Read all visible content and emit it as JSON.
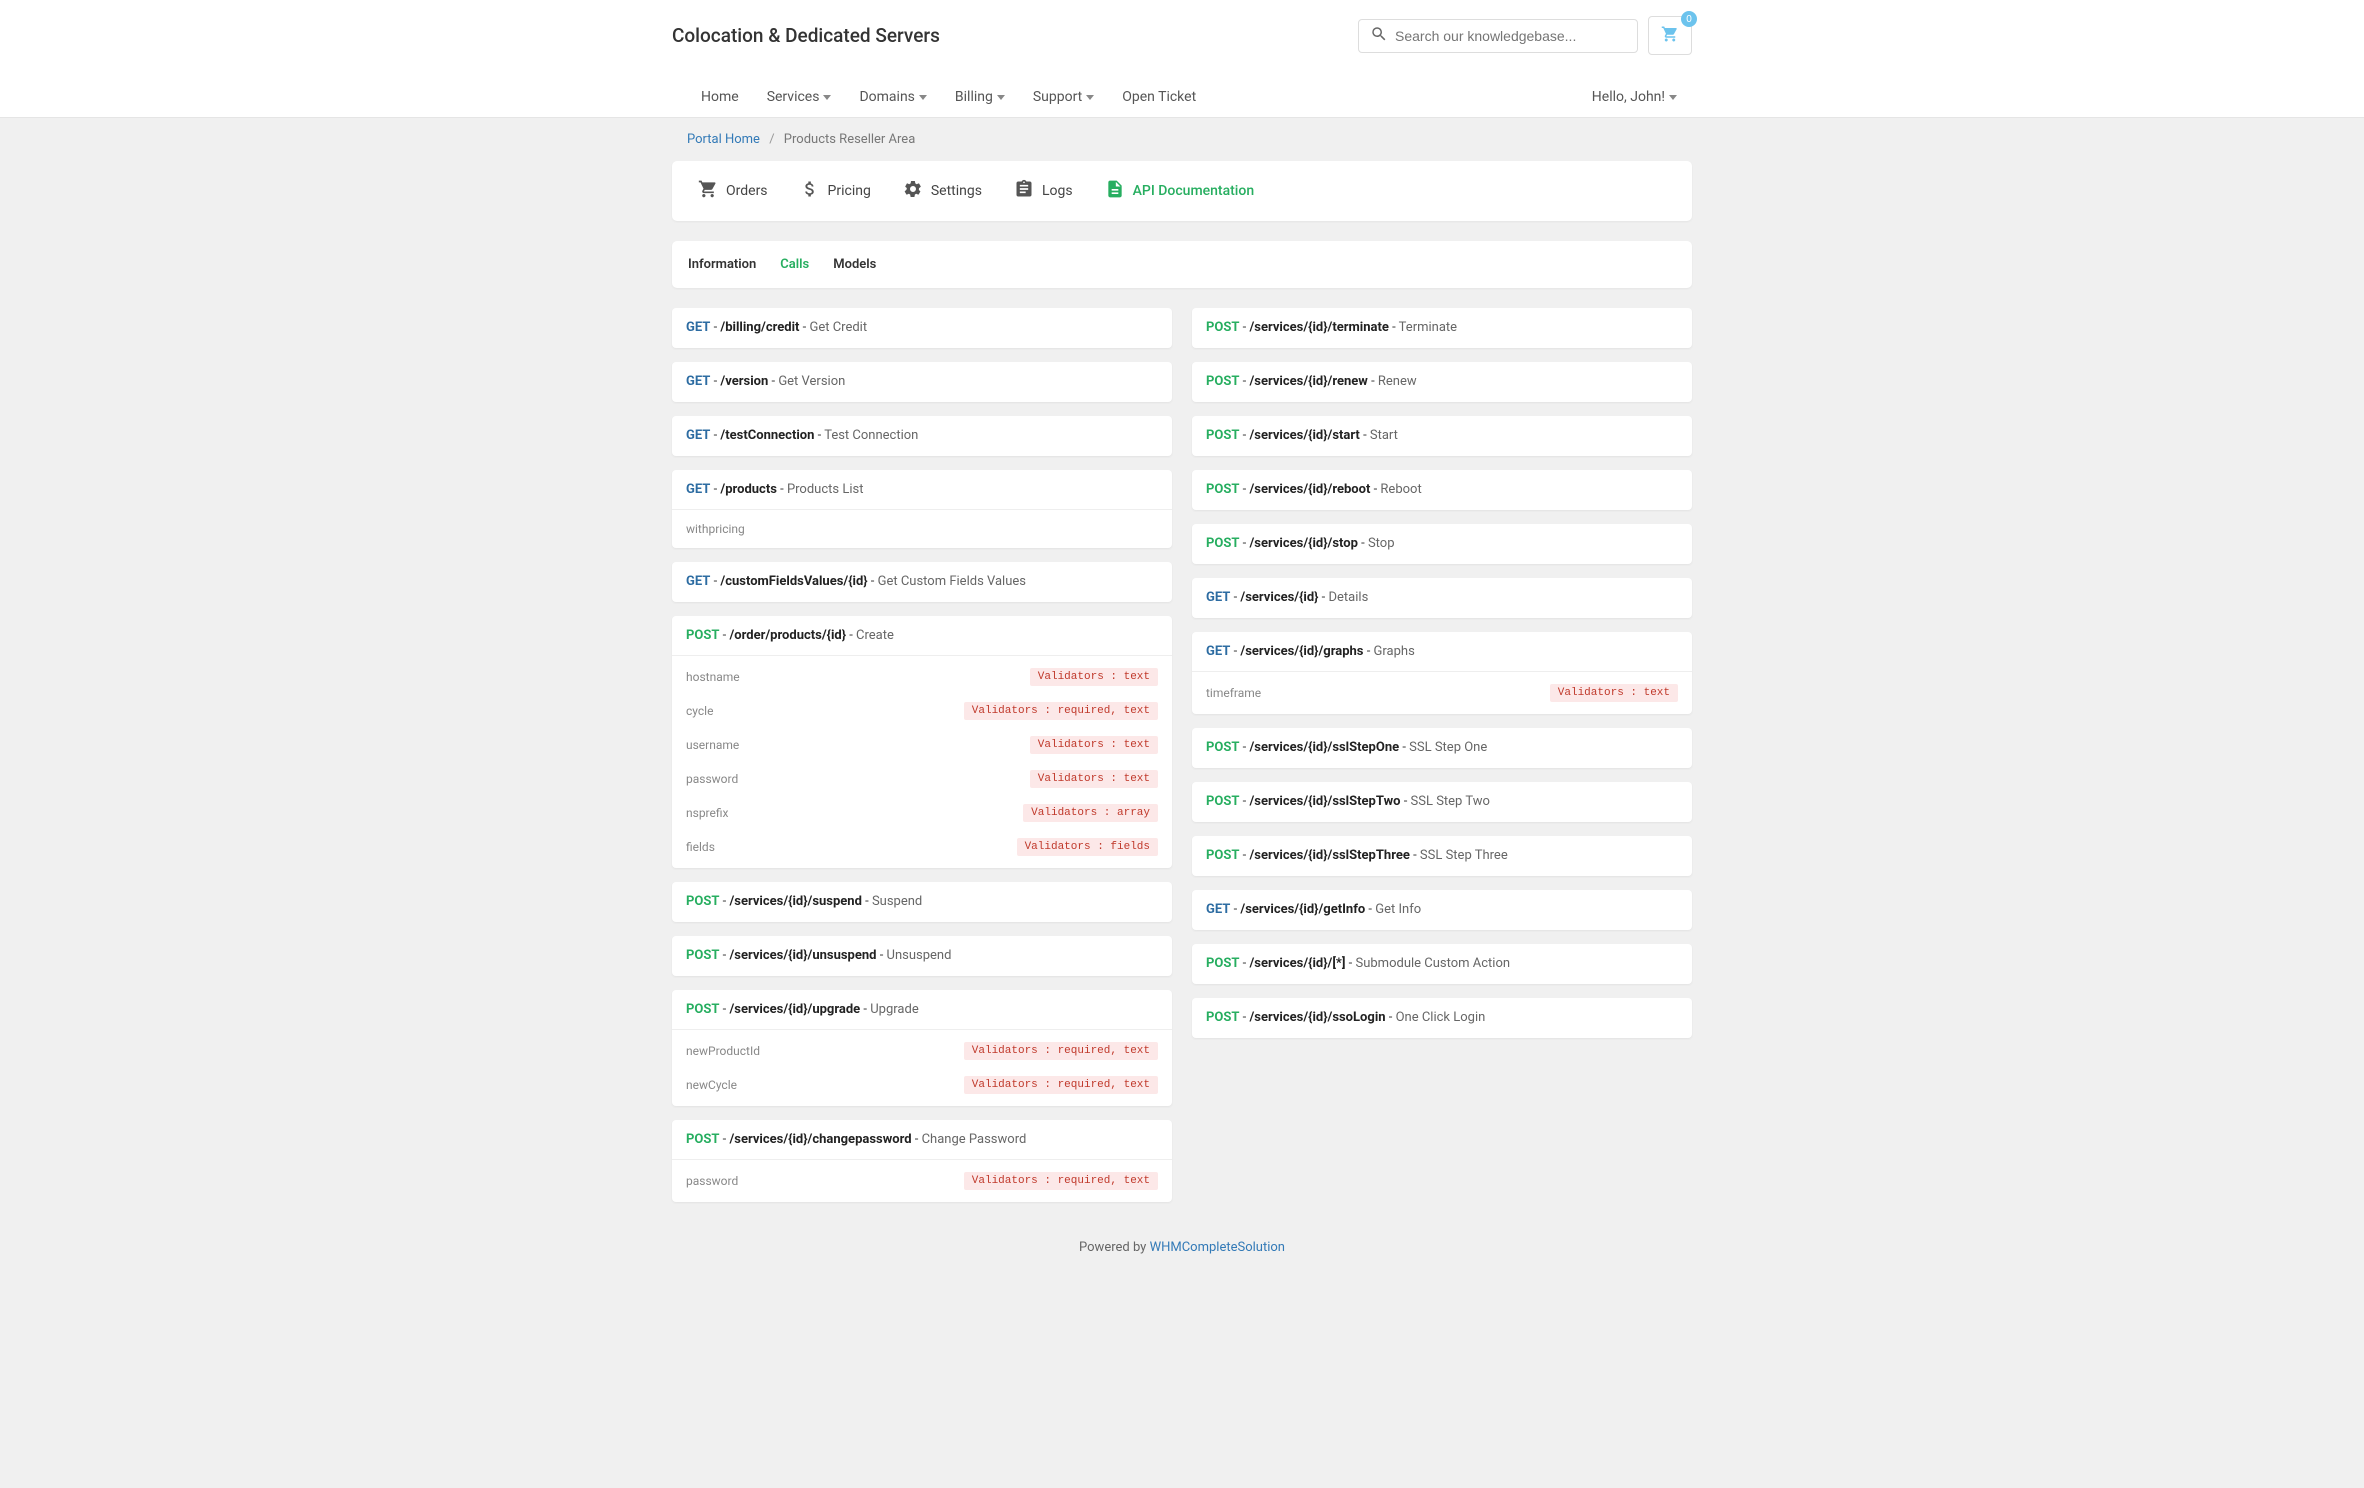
{
  "header": {
    "title": "Colocation & Dedicated Servers",
    "search_placeholder": "Search our knowledgebase...",
    "cart_count": "0"
  },
  "nav": {
    "items": [
      {
        "label": "Home",
        "dropdown": false
      },
      {
        "label": "Services",
        "dropdown": true
      },
      {
        "label": "Domains",
        "dropdown": true
      },
      {
        "label": "Billing",
        "dropdown": true
      },
      {
        "label": "Support",
        "dropdown": true
      },
      {
        "label": "Open Ticket",
        "dropdown": false
      }
    ],
    "greeting": "Hello, John!"
  },
  "breadcrumb": {
    "home": "Portal Home",
    "current": "Products Reseller Area"
  },
  "tabs": [
    {
      "icon": "cart",
      "label": "Orders",
      "active": false
    },
    {
      "icon": "dollar",
      "label": "Pricing",
      "active": false
    },
    {
      "icon": "gear",
      "label": "Settings",
      "active": false
    },
    {
      "icon": "clipboard",
      "label": "Logs",
      "active": false
    },
    {
      "icon": "doc",
      "label": "API Documentation",
      "active": true
    }
  ],
  "sub_tabs": [
    {
      "label": "Information",
      "active": false
    },
    {
      "label": "Calls",
      "active": true
    },
    {
      "label": "Models",
      "active": false
    }
  ],
  "api": {
    "left": [
      {
        "method": "GET",
        "path": "/billing/credit",
        "desc": "Get Credit"
      },
      {
        "method": "GET",
        "path": "/version",
        "desc": "Get Version"
      },
      {
        "method": "GET",
        "path": "/testConnection",
        "desc": "Test Connection"
      },
      {
        "method": "GET",
        "path": "/products",
        "desc": "Products List",
        "params": [
          {
            "name": "withpricing",
            "validators": ""
          }
        ]
      },
      {
        "method": "GET",
        "path": "/customFieldsValues/{id}",
        "desc": "Get Custom Fields Values"
      },
      {
        "method": "POST",
        "path": "/order/products/{id}",
        "desc": "Create",
        "params": [
          {
            "name": "hostname",
            "validators": "Validators : text"
          },
          {
            "name": "cycle",
            "validators": "Validators : required, text"
          },
          {
            "name": "username",
            "validators": "Validators : text"
          },
          {
            "name": "password",
            "validators": "Validators : text"
          },
          {
            "name": "nsprefix",
            "validators": "Validators : array"
          },
          {
            "name": "fields",
            "validators": "Validators : fields"
          }
        ]
      },
      {
        "method": "POST",
        "path": "/services/{id}/suspend",
        "desc": "Suspend"
      },
      {
        "method": "POST",
        "path": "/services/{id}/unsuspend",
        "desc": "Unsuspend"
      },
      {
        "method": "POST",
        "path": "/services/{id}/upgrade",
        "desc": "Upgrade",
        "params": [
          {
            "name": "newProductId",
            "validators": "Validators : required, text"
          },
          {
            "name": "newCycle",
            "validators": "Validators : required, text"
          }
        ]
      },
      {
        "method": "POST",
        "path": "/services/{id}/changepassword",
        "desc": "Change Password",
        "params": [
          {
            "name": "password",
            "validators": "Validators : required, text"
          }
        ]
      }
    ],
    "right": [
      {
        "method": "POST",
        "path": "/services/{id}/terminate",
        "desc": "Terminate"
      },
      {
        "method": "POST",
        "path": "/services/{id}/renew",
        "desc": "Renew"
      },
      {
        "method": "POST",
        "path": "/services/{id}/start",
        "desc": "Start"
      },
      {
        "method": "POST",
        "path": "/services/{id}/reboot",
        "desc": "Reboot"
      },
      {
        "method": "POST",
        "path": "/services/{id}/stop",
        "desc": "Stop"
      },
      {
        "method": "GET",
        "path": "/services/{id}",
        "desc": "Details"
      },
      {
        "method": "GET",
        "path": "/services/{id}/graphs",
        "desc": "Graphs",
        "params": [
          {
            "name": "timeframe",
            "validators": "Validators : text"
          }
        ]
      },
      {
        "method": "POST",
        "path": "/services/{id}/sslStepOne",
        "desc": "SSL Step One"
      },
      {
        "method": "POST",
        "path": "/services/{id}/sslStepTwo",
        "desc": "SSL Step Two"
      },
      {
        "method": "POST",
        "path": "/services/{id}/sslStepThree",
        "desc": "SSL Step Three"
      },
      {
        "method": "GET",
        "path": "/services/{id}/getInfo",
        "desc": "Get Info"
      },
      {
        "method": "POST",
        "path": "/services/{id}/[*]",
        "desc": "Submodule Custom Action"
      },
      {
        "method": "POST",
        "path": "/services/{id}/ssoLogin",
        "desc": "One Click Login"
      }
    ]
  },
  "footer": {
    "prefix": "Powered by ",
    "link": "WHMCompleteSolution"
  }
}
